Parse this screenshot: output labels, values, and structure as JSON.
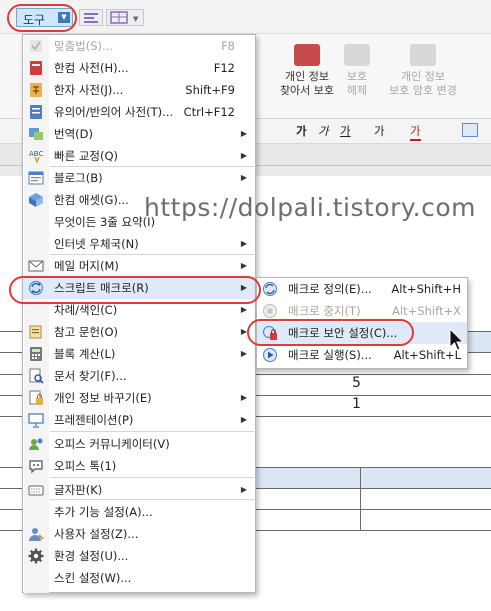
{
  "toolbar": {
    "tool_tab_label": "도구"
  },
  "ribbon": {
    "privacy_find_protect": "개인 정보\n찾아서 보호",
    "privacy_unprotect": "보호\n해제",
    "privacy_change_pw": "개인 정보\n보호 암호 변경"
  },
  "format_bar": {
    "glyphs": [
      "가",
      "가",
      "가",
      "가",
      "가"
    ]
  },
  "doc": {
    "cells": [
      "5",
      "1"
    ]
  },
  "main_menu": {
    "items": [
      {
        "label": "맞춤법(S)...",
        "shortcut": "F8",
        "disabled": true,
        "icon": "spellcheck-icon"
      },
      {
        "label": "한컴 사전(H)...",
        "shortcut": "F12",
        "icon": "dictionary-icon"
      },
      {
        "label": "한자 사전(J)...",
        "shortcut": "Shift+F9",
        "icon": "hanja-dictionary-icon"
      },
      {
        "label": "유의어/반의어 사전(T)...",
        "shortcut": "Ctrl+F12",
        "icon": "thesaurus-icon"
      },
      {
        "label": "번역(D)",
        "submenu": true,
        "icon": "translate-icon"
      },
      {
        "label": "빠른 교정(Q)",
        "submenu": true,
        "icon": "quick-correct-icon"
      },
      {
        "label": "블로그(B)",
        "submenu": true,
        "icon": "blog-icon"
      },
      {
        "label": "한컴 애셋(G)...",
        "icon": "asset-icon"
      },
      {
        "label": "무엇이든 3줄 요약(I)",
        "icon": ""
      },
      {
        "label": "인터넷 우체국(N)",
        "submenu": true,
        "icon": ""
      },
      {
        "label": "메일 머지(M)",
        "submenu": true,
        "icon": "mail-merge-icon"
      },
      {
        "label": "스크립트 매크로(R)",
        "submenu": true,
        "icon": "script-macro-icon",
        "highlighted": true
      },
      {
        "label": "차례/색인(C)",
        "submenu": true,
        "icon": ""
      },
      {
        "label": "참고 문헌(O)",
        "submenu": true,
        "icon": "reference-icon"
      },
      {
        "label": "블록 계산(L)",
        "submenu": true,
        "icon": "block-calc-icon"
      },
      {
        "label": "문서 찾기(F)...",
        "icon": "find-document-icon"
      },
      {
        "label": "개인 정보 바꾸기(E)",
        "submenu": true,
        "icon": "privacy-change-icon"
      },
      {
        "label": "프레젠테이션(P)",
        "submenu": true,
        "icon": "presentation-icon"
      },
      {
        "label": "오피스 커뮤니케이터(V)",
        "icon": "communicator-icon"
      },
      {
        "label": "오피스 톡(1)",
        "icon": "office-talk-icon"
      },
      {
        "label": "글자판(K)",
        "submenu": true,
        "icon": "keyboard-icon"
      },
      {
        "label": "추가 기능 설정(A)...",
        "icon": ""
      },
      {
        "label": "사용자 설정(Z)...",
        "icon": "user-settings-icon"
      },
      {
        "label": "환경 설정(U)...",
        "icon": "gear-icon"
      },
      {
        "label": "스킨 설정(W)...",
        "icon": ""
      }
    ]
  },
  "macro_submenu": {
    "items": [
      {
        "label": "매크로 정의(E)...",
        "shortcut": "Alt+Shift+H",
        "icon": "macro-define-icon"
      },
      {
        "label": "매크로 중지(T)",
        "shortcut": "Alt+Shift+X",
        "disabled": true,
        "icon": "macro-stop-icon"
      },
      {
        "label": "매크로 보안 설정(C)...",
        "shortcut": "",
        "icon": "macro-security-icon",
        "highlighted": true
      },
      {
        "label": "매크로 실행(S)...",
        "shortcut": "Alt+Shift+L",
        "icon": "macro-run-icon"
      }
    ]
  },
  "watermark": "https://dolpali.tistory.com",
  "colors": {
    "highlight": "#dfe9f7",
    "annotation": "#e03a3a",
    "tool_tab": "#cfe6f8"
  }
}
